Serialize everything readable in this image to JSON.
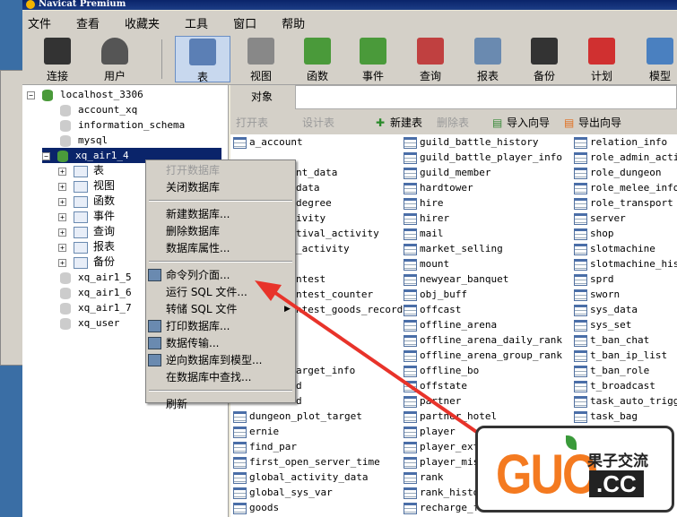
{
  "window": {
    "title": "Navicat Premium"
  },
  "menubar": [
    "文件",
    "查看",
    "收藏夹",
    "工具",
    "窗口",
    "帮助"
  ],
  "toolbar": [
    {
      "label": "连接",
      "icon": "plug-server-icon"
    },
    {
      "label": "用户",
      "icon": "user-icon"
    },
    {
      "label": "表",
      "icon": "table-icon",
      "active": true
    },
    {
      "label": "视图",
      "icon": "view-glasses-icon"
    },
    {
      "label": "函数",
      "icon": "function-icon"
    },
    {
      "label": "事件",
      "icon": "event-clock-icon"
    },
    {
      "label": "查询",
      "icon": "query-icon"
    },
    {
      "label": "报表",
      "icon": "report-icon"
    },
    {
      "label": "备份",
      "icon": "backup-tape-icon"
    },
    {
      "label": "计划",
      "icon": "calendar-icon"
    },
    {
      "label": "模型",
      "icon": "model-icon"
    }
  ],
  "tree": {
    "connection": "localhost_3306",
    "databases_before": [
      "account_xq",
      "information_schema",
      "mysql"
    ],
    "selected": "xq_air1_4",
    "children": [
      "表",
      "视图",
      "函数",
      "事件",
      "查询",
      "报表",
      "备份"
    ],
    "databases_after": [
      "xq_air1_5",
      "xq_air1_6",
      "xq_air1_7",
      "xq_user"
    ]
  },
  "tabs": {
    "objects": "对象"
  },
  "objbar": {
    "open": "打开表",
    "design": "设计表",
    "new": "新建表",
    "delete": "删除表",
    "import": "导入向导",
    "export": "导出向导"
  },
  "context_menu": {
    "groups": [
      [
        {
          "label": "打开数据库",
          "disabled": true
        },
        {
          "label": "关闭数据库"
        }
      ],
      [
        {
          "label": "新建数据库..."
        },
        {
          "label": "删除数据库"
        },
        {
          "label": "数据库属性..."
        }
      ],
      [
        {
          "label": "命令列介面...",
          "icon": "console-icon"
        },
        {
          "label": "运行 SQL 文件..."
        },
        {
          "label": "转储 SQL 文件",
          "submenu": true
        },
        {
          "label": "打印数据库...",
          "icon": "printer-icon"
        },
        {
          "label": "数据传输...",
          "icon": "data-transfer-icon"
        },
        {
          "label": "逆向数据库到模型...",
          "icon": "model-icon"
        },
        {
          "label": "在数据库中查找..."
        }
      ],
      [
        {
          "label": "刷新"
        }
      ]
    ]
  },
  "tables": {
    "col1": [
      "a_account",
      "",
      "nt_data",
      "data",
      "degree",
      "ivity",
      "tival_activity",
      "_activity",
      "",
      "ntest",
      "ntest_counter",
      "ntest_goods_record",
      "",
      "",
      "",
      "arget_info",
      "d",
      "d",
      "dungeon_plot_target",
      "ernie",
      "find_par",
      "first_open_server_time",
      "global_activity_data",
      "global_sys_var",
      "goods"
    ],
    "col2": [
      "guild_battle_history",
      "guild_battle_player_info",
      "guild_member",
      "hardtower",
      "hire",
      "hirer",
      "mail",
      "market_selling",
      "mount",
      "newyear_banquet",
      "obj_buff",
      "offcast",
      "offline_arena",
      "offline_arena_daily_rank",
      "offline_arena_group_rank",
      "offline_bo",
      "offstate",
      "partner",
      "partner_hotel",
      "player",
      "player_ext",
      "player_mis",
      "rank",
      "rank_histo",
      "recharge_fe"
    ],
    "col3": [
      "relation_info",
      "role_admin_activ",
      "role_dungeon",
      "role_melee_info",
      "role_transport",
      "server",
      "shop",
      "slotmachine",
      "slotmachine_histo",
      "sprd",
      "sworn",
      "sys_data",
      "sys_set",
      "t_ban_chat",
      "t_ban_ip_list",
      "t_ban_role",
      "t_broadcast",
      "task_auto_trigger",
      "task_bag"
    ]
  },
  "watermark": {
    "brand": "GUO",
    "cn": "果子交流",
    "tld": ".CC"
  },
  "colors": {
    "selection": "#0a246a",
    "arrow": "#e8332a",
    "watermark_orange": "#f47a20"
  }
}
